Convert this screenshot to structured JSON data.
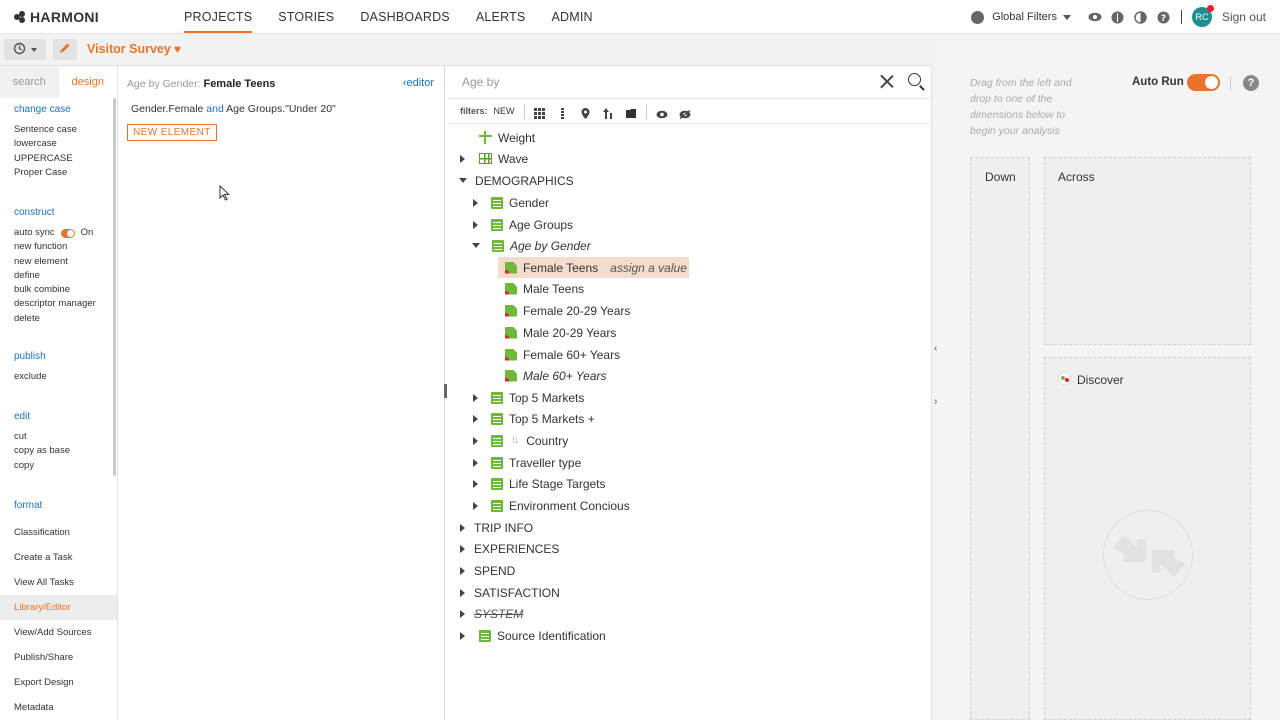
{
  "app": {
    "logo": "HARMONI"
  },
  "nav": [
    {
      "label": "PROJECTS",
      "active": true
    },
    {
      "label": "STORIES"
    },
    {
      "label": "DASHBOARDS"
    },
    {
      "label": "ALERTS"
    },
    {
      "label": "ADMIN"
    }
  ],
  "topbar": {
    "global_filters": "Global Filters",
    "avatar": "RC",
    "sign_out": "Sign out"
  },
  "subbar": {
    "title": "Visitor Survey",
    "heart": "♥"
  },
  "sidebar": {
    "tabs": [
      "search",
      "design"
    ],
    "sections": {
      "change_case": {
        "head": "change case",
        "items": [
          "Sentence case",
          "lowercase",
          "UPPERCASE",
          "Proper Case"
        ]
      },
      "construct": {
        "head": "construct",
        "auto_sync": "auto sync",
        "auto_sync_state": "On",
        "items": [
          "new function",
          "new element",
          "define",
          "bulk combine",
          "descriptor manager",
          "delete"
        ]
      },
      "publish": {
        "head": "publish",
        "items": [
          "exclude"
        ]
      },
      "edit": {
        "head": "edit",
        "items": [
          "cut",
          "copy as base",
          "copy"
        ]
      },
      "format": {
        "head": "format"
      }
    },
    "links": [
      "Classification",
      "Create a Task",
      "View All Tasks",
      "Library/Editor",
      "View/Add Sources",
      "Publish/Share",
      "Export Design",
      "Metadata"
    ]
  },
  "editor": {
    "breadcrumb_parent": "Age by Gender:",
    "breadcrumb_current": "Female Teens",
    "editor_link": "editor",
    "expr_left": "Gender.Female",
    "expr_op": "and",
    "expr_right": "Age Groups.\"Under 20\"",
    "new_element": "NEW ELEMENT"
  },
  "tree": {
    "search_placeholder": "Age by",
    "filters_label": "filters:",
    "filters_new": "NEW",
    "rows": {
      "weight": "Weight",
      "wave": "Wave",
      "demographics": "DEMOGRAPHICS",
      "gender": "Gender",
      "age_groups": "Age Groups",
      "age_by_gender": "Age by Gender",
      "female_teens": "Female Teens",
      "assign_hint": "assign a value",
      "male_teens": "Male Teens",
      "female_20_29": "Female 20-29 Years",
      "male_20_29": "Male 20-29 Years",
      "female_60": "Female 60+ Years",
      "male_60": "Male 60+ Years",
      "top5": "Top 5 Markets",
      "top5plus": "Top 5 Markets +",
      "country": "Country",
      "traveller": "Traveller type",
      "life_stage": "Life Stage Targets",
      "environment": "Environment Concious",
      "trip_info": "TRIP INFO",
      "experiences": "EXPERIENCES",
      "spend": "SPEND",
      "satisfaction": "SATISFACTION",
      "system": "SYSTEM",
      "source_id": "Source Identification"
    }
  },
  "right_panel": {
    "hint": "Drag from the left and drop to one of the dimensions below to begin your analysis",
    "auto_run": "Auto Run",
    "help": "?",
    "down": "Down",
    "across": "Across",
    "discover": "Discover"
  },
  "colors": {
    "accent": "#e8742a",
    "link": "#1a73c8",
    "variable_green": "#6fb83a",
    "highlight": "#f3dccb"
  }
}
